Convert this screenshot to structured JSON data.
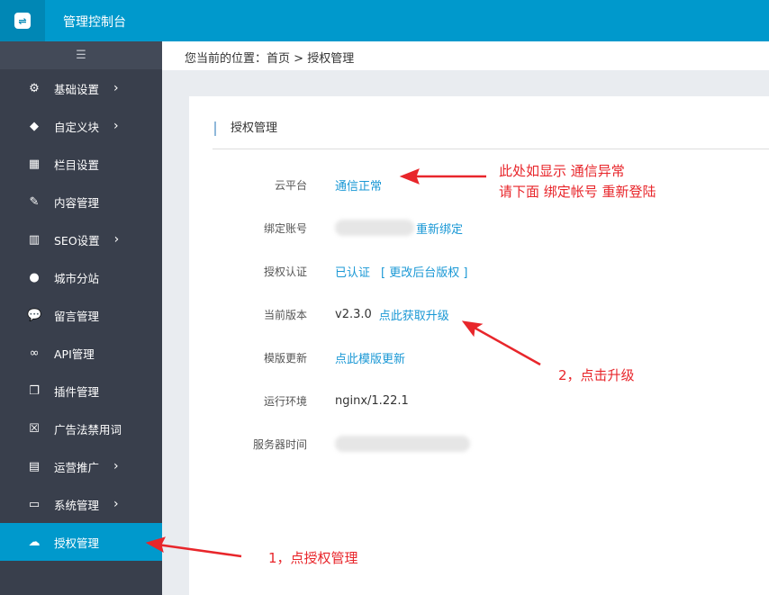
{
  "header": {
    "title": "管理控制台",
    "logo_icon": "cloud-logo-icon"
  },
  "sidebar": {
    "toggle_icon": "collapse-menu-icon",
    "items": [
      {
        "label": "基础设置",
        "icon": "gear-icon",
        "has_submenu": true
      },
      {
        "label": "自定义块",
        "icon": "tag-icon",
        "has_submenu": true
      },
      {
        "label": "栏目设置",
        "icon": "grid-icon",
        "has_submenu": false
      },
      {
        "label": "内容管理",
        "icon": "edit-icon",
        "has_submenu": false
      },
      {
        "label": "SEO设置",
        "icon": "bar-chart-icon",
        "has_submenu": true
      },
      {
        "label": "城市分站",
        "icon": "globe-icon",
        "has_submenu": false
      },
      {
        "label": "留言管理",
        "icon": "comment-icon",
        "has_submenu": false
      },
      {
        "label": "API管理",
        "icon": "link-icon",
        "has_submenu": false
      },
      {
        "label": "插件管理",
        "icon": "copy-icon",
        "has_submenu": false
      },
      {
        "label": "广告法禁用词",
        "icon": "close-box-icon",
        "has_submenu": false
      },
      {
        "label": "运营推广",
        "icon": "table-icon",
        "has_submenu": true
      },
      {
        "label": "系统管理",
        "icon": "monitor-icon",
        "has_submenu": true
      },
      {
        "label": "授权管理",
        "icon": "cloud-upload-icon",
        "has_submenu": false,
        "active": true
      }
    ]
  },
  "breadcrumb": {
    "prefix": "您当前的位置：",
    "home": "首页",
    "sep": ">",
    "current": "授权管理"
  },
  "card": {
    "title": "授权管理",
    "rows": [
      {
        "label": "云平台",
        "link": "通信正常"
      },
      {
        "label": "绑定账号",
        "link": "重新绑定"
      },
      {
        "label": "授权认证",
        "link": "已认证",
        "link2": "[ 更改后台版权 ]"
      },
      {
        "label": "当前版本",
        "value": "v2.3.0",
        "link": "点此获取升级"
      },
      {
        "label": "模版更新",
        "link": "点此模版更新"
      },
      {
        "label": "运行环境",
        "value": "nginx/1.22.1"
      },
      {
        "label": "服务器时间"
      }
    ]
  },
  "annotations": {
    "note1_line1": "此处如显示 通信异常",
    "note1_line2": "请下面 绑定帐号 重新登陆",
    "note2": "2，点击升级",
    "note3": "1，点授权管理",
    "color": "#e8262b"
  }
}
